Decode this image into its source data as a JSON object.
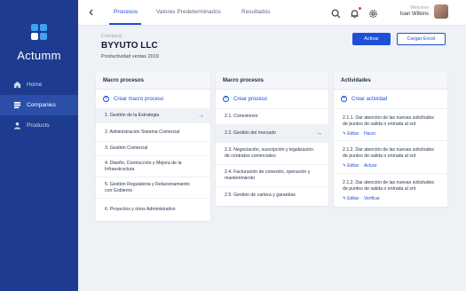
{
  "sidebar": {
    "brand": "Actumm",
    "items": [
      {
        "label": "Home",
        "icon": "home-icon",
        "active": false
      },
      {
        "label": "Companies",
        "icon": "companies-icon",
        "active": true
      },
      {
        "label": "Products",
        "icon": "user-icon",
        "active": false
      }
    ]
  },
  "topbar": {
    "tabs": [
      {
        "label": "Procesos",
        "active": true
      },
      {
        "label": "Valores Predeterminados",
        "active": false
      },
      {
        "label": "Resultados",
        "active": false
      }
    ],
    "icons": [
      "search-icon",
      "bell-icon",
      "gear-icon"
    ],
    "user": {
      "welcome": "Welcome",
      "name": "Ioan Wilkins"
    }
  },
  "company": {
    "label": "Company",
    "name": "BYYUTO LLC",
    "subtitle": "Productividad ventas 2019"
  },
  "actions": {
    "primary": "Activar",
    "secondary": "Cargar Excel"
  },
  "columns": {
    "macro": {
      "title": "Macro procesos",
      "create": "Crear macro proceso",
      "items": [
        "1. Gestión de la Estrategia",
        "2. Administración Sistema Comercial",
        "3. Gestión Comercial",
        "4. Diseño, Contrucción y Mejora de la Infraestructura",
        "5. Gestión Regulatoria y Relacionamiento con Gobierno",
        "6. Proyectos y otros Administrativo"
      ]
    },
    "procesos": {
      "title": "Macro procesos",
      "create": "Crear proceso",
      "items": [
        "2.1. Conexiones",
        "2.2. Gestión del mercado",
        "2.3. Negociación, suscripción y legalización de contratos comerciales",
        "2.4. Facturación de conexión, operación y mantenimiento",
        "2.5. Gestión de cartera y garantías"
      ]
    },
    "actividades": {
      "title": "Actividades",
      "create": "Crear actividad",
      "items": [
        {
          "text": "2.1.1. Dar atención de las nuevas solicitudes de puntos de salida o entrada al snt",
          "links": [
            "Editar",
            "Hacer"
          ]
        },
        {
          "text": "2.1.2. Dar atención de las nuevas solicitudes de puntos de salida o entrada al snt",
          "links": [
            "Editar",
            "Actuar"
          ]
        },
        {
          "text": "2.1.2. Dar atención de las nuevas solicitudes de puntos de salida o entrada al snt",
          "links": [
            "Editar",
            "Verificar"
          ]
        }
      ]
    }
  },
  "colors": {
    "sidebar": "#1d3c8f",
    "accent": "#1d4fd8",
    "background": "#eef1f5"
  }
}
